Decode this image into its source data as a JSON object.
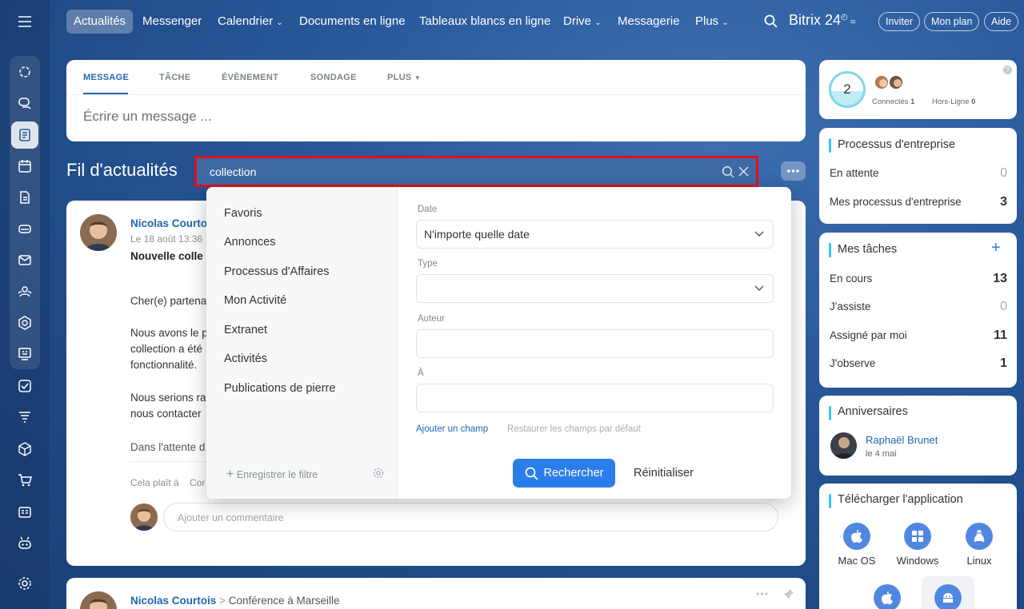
{
  "topnav": {
    "items": [
      "Actualités",
      "Messenger",
      "Calendrier",
      "Documents en ligne",
      "Tableaux blancs en ligne",
      "Drive",
      "Messagerie",
      "Plus"
    ],
    "brand": "Bitrix 24",
    "invite": "Inviter",
    "myplan": "Mon plan",
    "help": "Aide"
  },
  "composer": {
    "tabs": [
      "MESSAGE",
      "TÂCHE",
      "ÉVÈNEMENT",
      "SONDAGE",
      "PLUS"
    ],
    "placeholder": "Écrire un message ..."
  },
  "feed": {
    "title": "Fil d'actualités",
    "search_value": "collection"
  },
  "filter": {
    "presets": [
      "Favoris",
      "Annonces",
      "Processus d'Affaires",
      "Mon Activité",
      "Extranet",
      "Activités",
      "Publications de pierre"
    ],
    "save_filter": "Enregistrer le filtre",
    "date_label": "Date",
    "date_value": "N'importe quelle date",
    "type_label": "Type",
    "type_value": "",
    "author_label": "Auteur",
    "author_value": "",
    "to_label": "À",
    "to_value": "",
    "add_field": "Ajouter un champ",
    "restore_fields": "Restaurer les champs par défaut",
    "search_button": "Rechercher",
    "reset_button": "Réinitialiser"
  },
  "post1": {
    "author": "Nicolas Courto",
    "date": "Le 18 août 13:36",
    "title": "Nouvelle colle",
    "lines": [
      "Cher(e) partena",
      "Nous avons le p",
      "collection a été",
      "fonctionnalité.",
      "Nous serions ra",
      "nous contacter",
      "Dans l'attente d"
    ],
    "like": "Cela plaît à",
    "comment_short": "Cor",
    "comment_placeholder": "Ajouter un commentaire"
  },
  "post2": {
    "author": "Nicolas Courtois",
    "separator": ">",
    "target": "Conférence à Marseille"
  },
  "online": {
    "count": "2",
    "connected_label": "Connectés",
    "connected_value": "1",
    "offline_label": "Hors-Ligne",
    "offline_value": "0"
  },
  "processes": {
    "title": "Processus d'entreprise",
    "rows": [
      {
        "label": "En attente",
        "value": "0"
      },
      {
        "label": "Mes processus d'entreprise",
        "value": "3"
      }
    ]
  },
  "tasks": {
    "title": "Mes tâches",
    "add": "+",
    "rows": [
      {
        "label": "En cours",
        "value": "13"
      },
      {
        "label": "J'assiste",
        "value": "0"
      },
      {
        "label": "Assigné par moi",
        "value": "11"
      },
      {
        "label": "J'observe",
        "value": "1"
      }
    ]
  },
  "birthdays": {
    "title": "Anniversaires",
    "name": "Raphaël Brunet",
    "date": "le 4 mai"
  },
  "apps": {
    "title": "Télécharger l'application",
    "items": [
      "Mac OS",
      "Windows",
      "Linux"
    ]
  },
  "colors": {
    "accent": "#2067b0",
    "primary_button": "#2b7de9",
    "search_highlight": "#e0101a",
    "link": "#2067b0"
  },
  "icons": [
    "hamburger-icon",
    "search-icon",
    "close-icon",
    "chevron-down-icon",
    "gear-icon",
    "plus-icon",
    "more-icon",
    "pin-icon",
    "apple-icon",
    "windows-icon",
    "linux-icon",
    "android-icon"
  ]
}
